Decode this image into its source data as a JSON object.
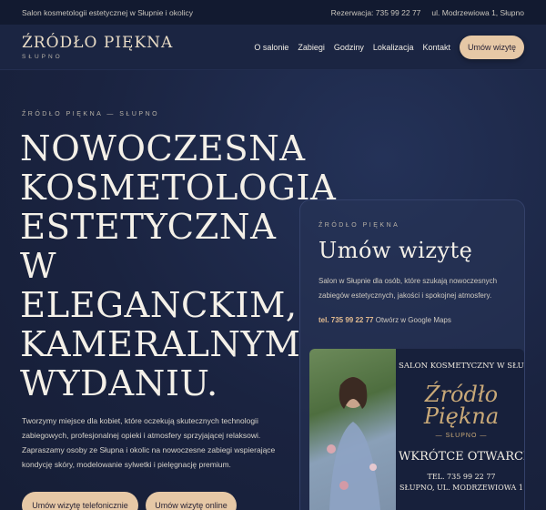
{
  "topbar": {
    "tagline": "Salon kosmetologii estetycznej w Słupnie i okolicy",
    "phone": "Rezerwacja: 735 99 22 77",
    "address": "ul. Modrzewiowa 1, Słupno"
  },
  "header": {
    "brand": "ŹRÓDŁO PIĘKNA",
    "brand_sub": "SŁUPNO",
    "nav": [
      "O salonie",
      "Zabiegi",
      "Godziny",
      "Lokalizacja",
      "Kontakt"
    ],
    "cta": "Umów wizytę"
  },
  "hero": {
    "eyebrow": "ŹRÓDŁO PIĘKNA — SŁUPNO",
    "headline": "Nowoczesna kosmetologia estetyczna w eleganckim, kameralnym wydaniu.",
    "intro": "Tworzymy miejsce dla kobiet, które oczekują skutecznych technologii zabiegowych, profesjonalnej opieki i atmosfery sprzyjającej relaksowi. Zapraszamy osoby ze Słupna i okolic na nowoczesne zabiegi wspierające kondycję skóry, modelowanie sylwetki i pielęgnację premium.",
    "button_phone": "Umów wizytę telefonicznie",
    "button_online": "Umów wizytę online"
  },
  "card": {
    "eyebrow": "ŹRÓDŁO PIĘKNA",
    "title": "Umów wizytę",
    "description": "Salon w Słupnie dla osób, które szukają nowoczesnych zabiegów estetycznych, jakości i spokojnej atmosfery.",
    "tel": "tel. 735 99 22 77",
    "maps_link": "Otwórz w Google Maps"
  },
  "poster": {
    "salon": "SALON KOSMETYCZNY W SŁUPNIE",
    "name": "Źródło Piękna",
    "sub": "— SŁUPNO —",
    "soon": "WKRÓTCE OTWARCIE",
    "tel": "TEL. 735 99 22 77",
    "address": "SŁUPNO, UL. MODRZEWIOWA 1"
  },
  "colors": {
    "background": "#1a2340",
    "accent": "#e6c8a6",
    "gold": "#c9a978"
  }
}
